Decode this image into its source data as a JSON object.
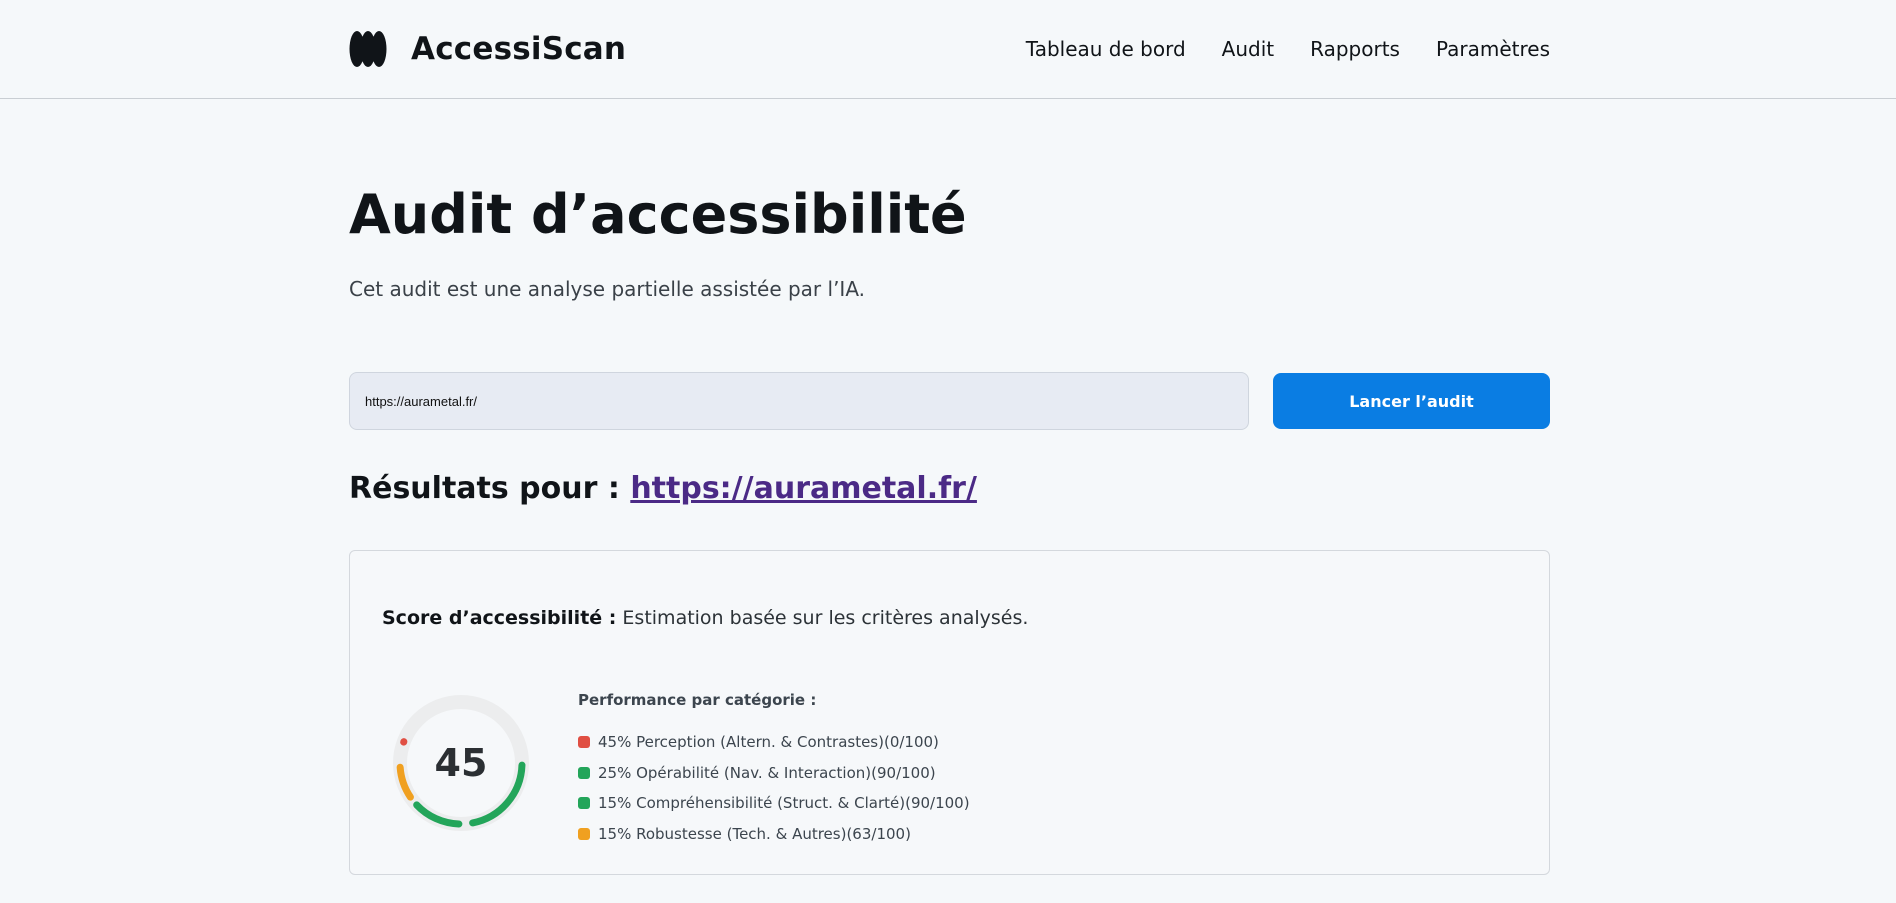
{
  "header": {
    "brand": "AccessiScan",
    "nav": [
      "Tableau de bord",
      "Audit",
      "Rapports",
      "Paramètres"
    ]
  },
  "page": {
    "title": "Audit d’accessibilité",
    "subtitle": "Cet audit est une analyse partielle assistée par l’IA."
  },
  "form": {
    "url_value": "https://aurametal.fr/",
    "submit_label": "Lancer l’audit"
  },
  "results": {
    "heading_prefix": "Résultats pour :",
    "url": "https://aurametal.fr/"
  },
  "score": {
    "label": "Score d’accessibilité :",
    "description": "Estimation basée sur les critères analysés.",
    "value": "45",
    "categories_title": "Performance par catégorie :",
    "categories": [
      {
        "text": "45% Perception (Altern. & Contrastes)(0/100)",
        "color": "#e04f43",
        "weight": 45,
        "score": 0
      },
      {
        "text": "25% Opérabilité (Nav. & Interaction)(90/100)",
        "color": "#23a55a",
        "weight": 25,
        "score": 90
      },
      {
        "text": "15% Compréhensibilité (Struct. & Clarté)(90/100)",
        "color": "#23a55a",
        "weight": 15,
        "score": 90
      },
      {
        "text": "15% Robustesse (Tech. & Autres)(63/100)",
        "color": "#f0a020",
        "weight": 15,
        "score": 63
      }
    ]
  },
  "colors": {
    "accent": "#0a7de3",
    "link": "#4b2a86",
    "gauge_track": "#ecedee"
  }
}
